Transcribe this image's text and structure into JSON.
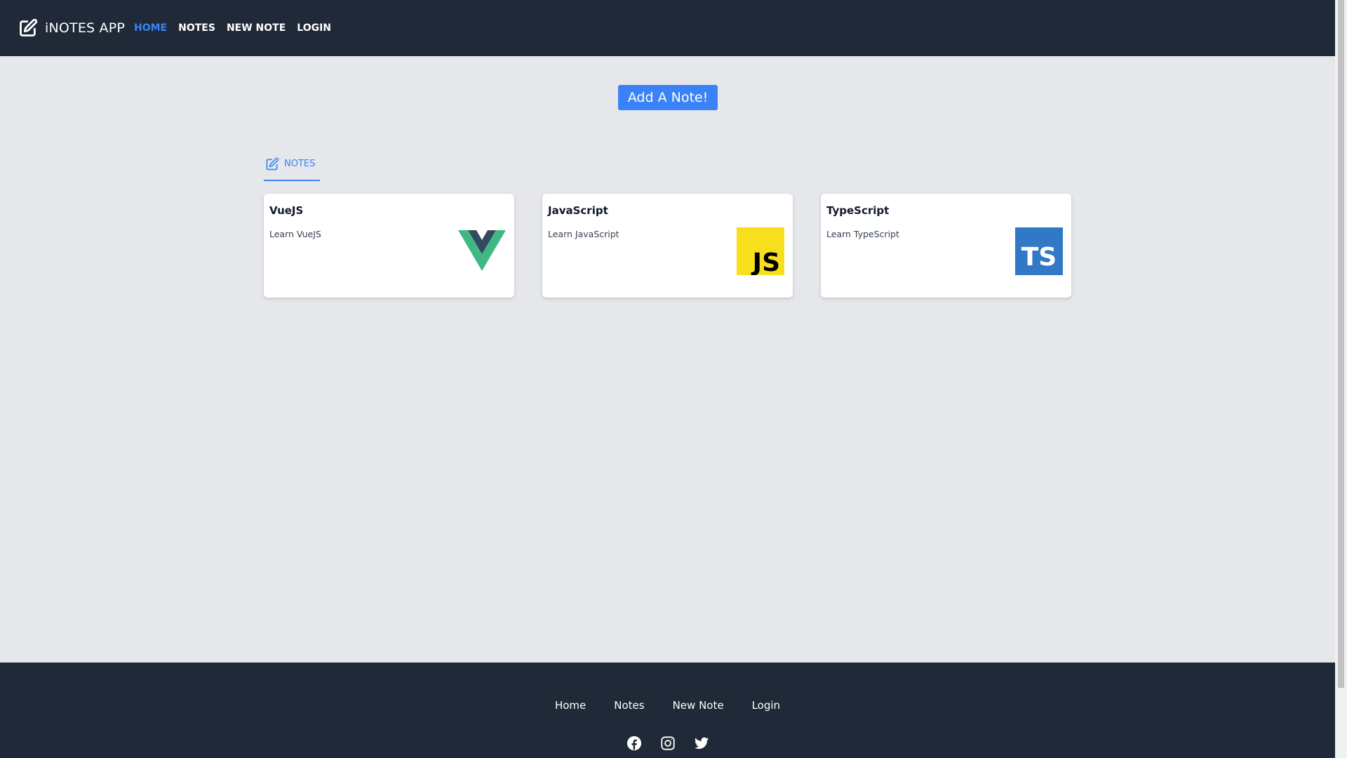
{
  "navbar": {
    "brand": "iNOTES APP",
    "links": [
      {
        "label": "HOME",
        "active": true
      },
      {
        "label": "NOTES",
        "active": false
      },
      {
        "label": "NEW NOTE",
        "active": false
      },
      {
        "label": "LOGIN",
        "active": false
      }
    ]
  },
  "main": {
    "add_button_label": "Add A Note!",
    "section_tab_label": "NOTES",
    "notes": [
      {
        "title": "VueJS",
        "description": "Learn VueJS",
        "logo": "vue-logo-icon"
      },
      {
        "title": "JavaScript",
        "description": "Learn JavaScript",
        "logo": "javascript-logo-icon"
      },
      {
        "title": "TypeScript",
        "description": "Learn TypeScript",
        "logo": "typescript-logo-icon"
      }
    ]
  },
  "footer": {
    "links": [
      "Home",
      "Notes",
      "New Note",
      "Login"
    ],
    "social": [
      "facebook-icon",
      "instagram-icon",
      "twitter-icon"
    ]
  },
  "colors": {
    "navbar_bg": "#1f2937",
    "page_bg": "#e5e7eb",
    "accent": "#3b82f6",
    "vue_green": "#41b883",
    "vue_dark": "#35495e",
    "js_yellow": "#f7df1e",
    "ts_blue": "#3178c6"
  }
}
